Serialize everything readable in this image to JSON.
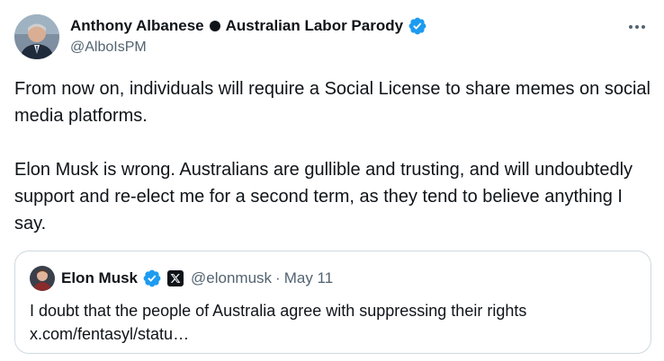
{
  "author": {
    "display_name_first": "Anthony Albanese",
    "display_name_second": "Australian Labor Parody",
    "handle": "@AlboIsPM",
    "verified_color": "#1d9bf0"
  },
  "icons": {
    "more": "more-options-icon",
    "verified": "verified-badge-icon",
    "x_logo": "x-logo-icon"
  },
  "tweet": {
    "paragraph_1": "From now on, individuals will require a Social License to share memes on social media platforms.",
    "paragraph_2": "Elon Musk is wrong. Australians are gullible and trusting, and will undoubtedly support and re-elect me for a second term, as they tend to believe anything I say."
  },
  "quoted_tweet": {
    "display_name": "Elon Musk",
    "handle": "@elonmusk",
    "separator": "·",
    "date": "May 11",
    "text_line_1": "I doubt that the people of Australia agree with suppressing their rights",
    "text_line_2": "x.com/fentasyl/statu…"
  }
}
